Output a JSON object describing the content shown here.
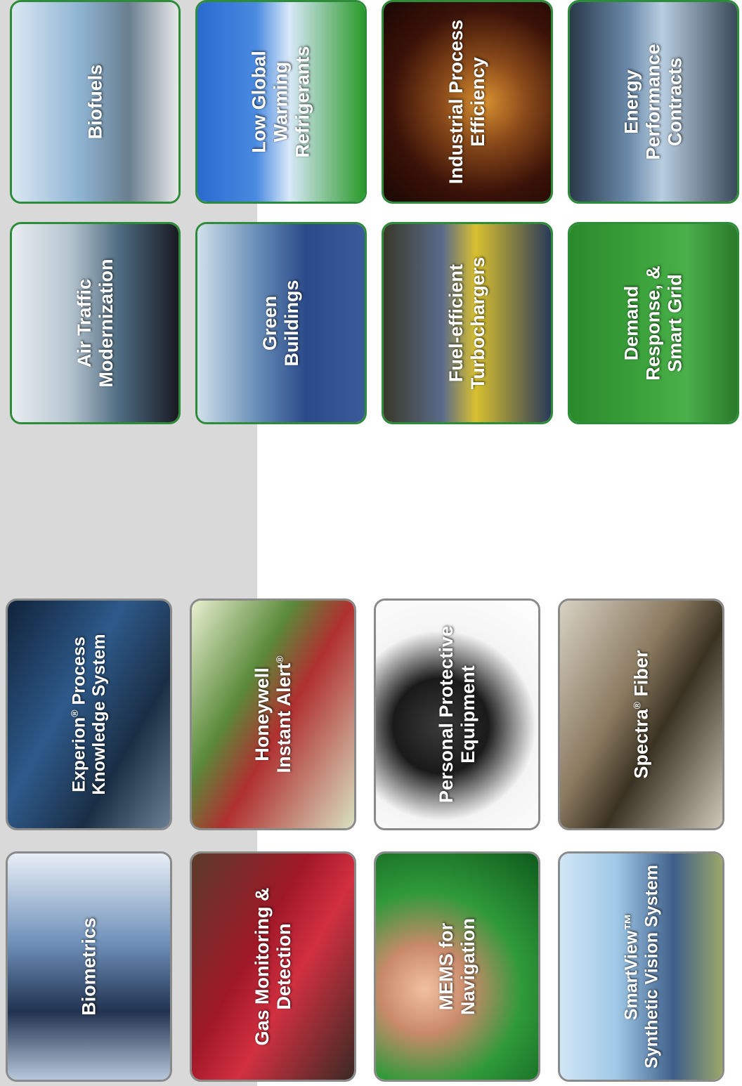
{
  "tiles": {
    "biometrics": "Biometrics",
    "gas_line1": "Gas Monitoring &",
    "gas_line2": "Detection",
    "mems_line1": "MEMS for",
    "mems_line2": "Navigation",
    "smart_line1": "SmartView™",
    "smart_line2": "Synthetic Vision System",
    "experion_line1_a": "Experion",
    "experion_line1_b": " Process",
    "experion_line2": "Knowledge System",
    "instant_line1": "Honeywell",
    "instant_line2": "Instant Alert",
    "ppe_line1": "Personal Protective",
    "ppe_line2": "Equipment",
    "spectra_a": "Spectra",
    "spectra_b": " Fiber",
    "airtraffic_line1": "Air Traffic",
    "airtraffic_line2": "Modernization",
    "biofuels": "Biofuels",
    "green_line1": "Green",
    "green_line2": "Buildings",
    "refrig_line1": "Low Global",
    "refrig_line2": "Warming",
    "refrig_line3": "Refrigerants",
    "turbo_line1": "Fuel-efficient",
    "turbo_line2": "Turbochargers",
    "industrial_line1": "Industrial Process",
    "industrial_line2": "Efficiency",
    "demand_line1": "Demand",
    "demand_line2": "Response, &",
    "demand_line3": "Smart Grid",
    "energy_line1": "Energy",
    "energy_line2": "Performance",
    "energy_line3": "Contracts"
  },
  "symbols": {
    "registered": "®"
  },
  "colors": {
    "green_border": "#2e8b3a",
    "grey_border": "#8a8a8a",
    "gray_band": "#d9d9d9"
  }
}
